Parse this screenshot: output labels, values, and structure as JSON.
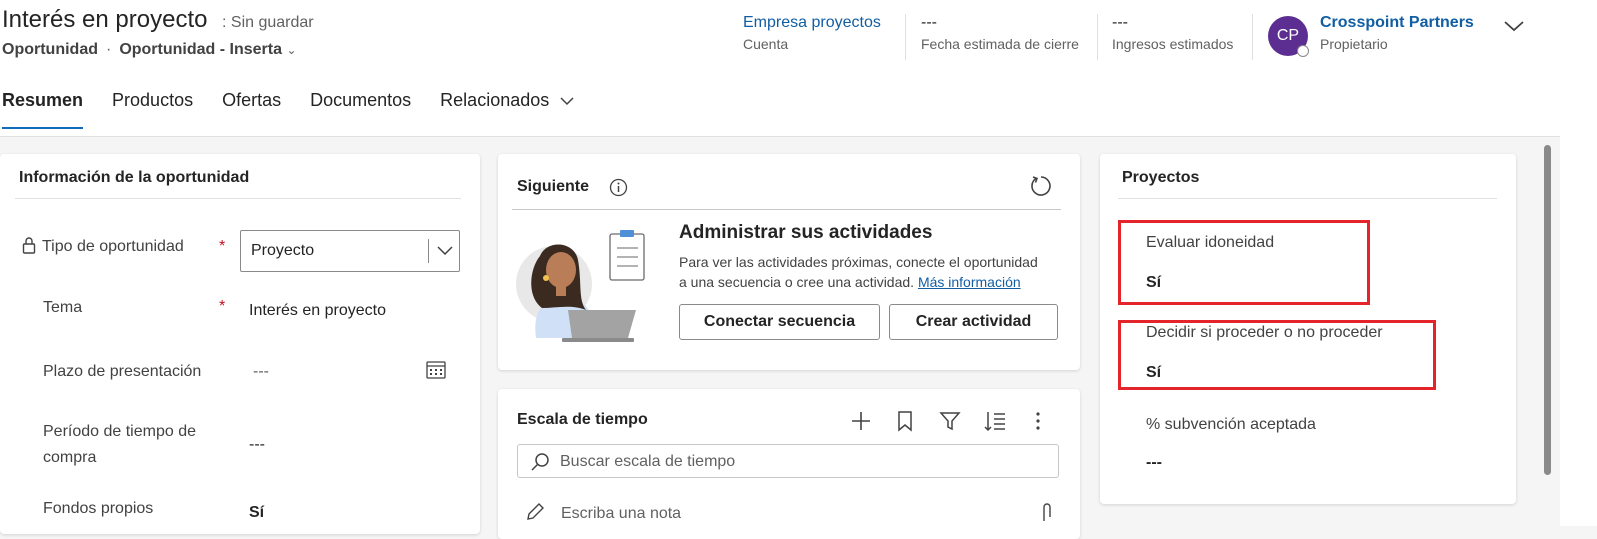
{
  "header": {
    "title": "Interés en proyecto",
    "save_status": ": Sin guardar",
    "entity": "Oportunidad",
    "separator": "·",
    "form_selector": "Oportunidad - Inserta",
    "fields": [
      {
        "value": "Empresa proyectos",
        "label": "Cuenta"
      },
      {
        "value": "---",
        "label": "Fecha estimada de cierre"
      },
      {
        "value": "---",
        "label": "Ingresos estimados"
      }
    ],
    "owner": {
      "initials": "CP",
      "name": "Crosspoint Partners",
      "label": "Propietario"
    }
  },
  "tabs": [
    "Resumen",
    "Productos",
    "Ofertas",
    "Documentos",
    "Relacionados"
  ],
  "info_card": {
    "title": "Información de la oportunidad",
    "fields": [
      {
        "label": "Tipo de oportunidad",
        "required": "*",
        "value": "Proyecto"
      },
      {
        "label": "Tema",
        "required": "*",
        "value": "Interés en proyecto"
      },
      {
        "label": "Plazo de presentación",
        "value": "---"
      },
      {
        "label_line1": "Período de tiempo de",
        "label_line2": "compra",
        "value": "---"
      },
      {
        "label": "Fondos propios",
        "value": "Sí"
      }
    ]
  },
  "next_card": {
    "title": "Siguiente",
    "heading": "Administrar sus actividades",
    "body_line1": "Para ver las actividades próximas, conecte el oportunidad",
    "body_line2": "a una secuencia o cree una actividad.",
    "link": "Más información",
    "btn_connect": "Conectar secuencia",
    "btn_create": "Crear actividad"
  },
  "timeline_card": {
    "title": "Escala de tiempo",
    "search_placeholder": "Buscar escala de tiempo",
    "note_placeholder": "Escriba una nota"
  },
  "projects_card": {
    "title": "Proyectos",
    "fields": [
      {
        "label": "Evaluar idoneidad",
        "value": "Sí"
      },
      {
        "label": "Decidir si proceder o no proceder",
        "value": "Sí"
      },
      {
        "label": "% subvención aceptada",
        "value": "---"
      }
    ]
  },
  "colors": {
    "accent": "#0f6cbd",
    "link": "#115ea3",
    "highlight": "#e3242b",
    "avatar": "#5c2e91"
  }
}
